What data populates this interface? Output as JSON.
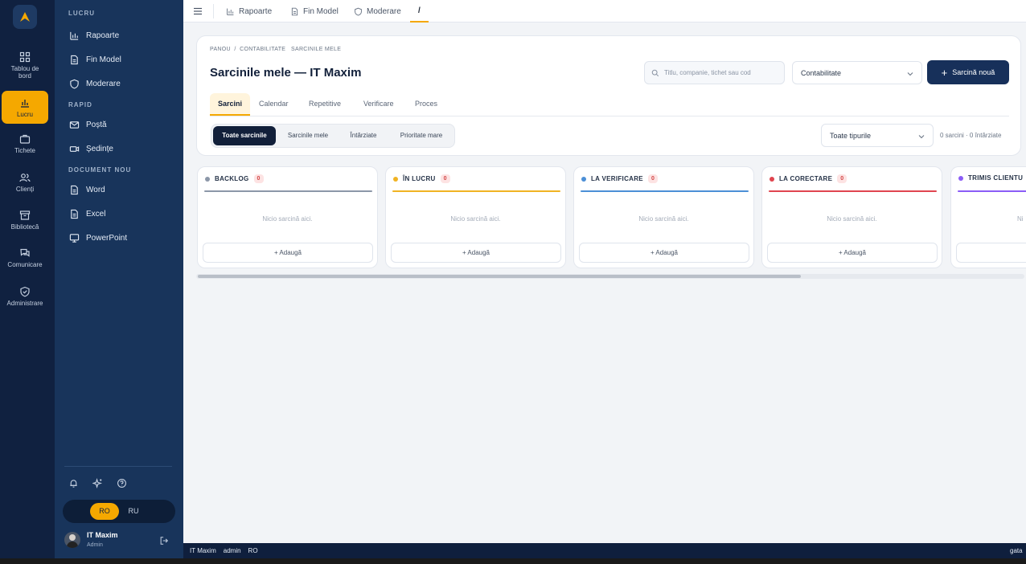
{
  "colors": {
    "accent": "#f5a800",
    "rail_bg": "#102140",
    "panel_bg": "#18345b",
    "primary_btn": "#17305a",
    "status_ok": "#46d36a"
  },
  "rail": {
    "items": [
      {
        "label": "Tablou de bord",
        "icon": "grid-icon"
      },
      {
        "label": "Lucru",
        "icon": "bar-chart-icon",
        "active": true
      },
      {
        "label": "Tichete",
        "icon": "briefcase-icon"
      },
      {
        "label": "Clienți",
        "icon": "users-icon"
      },
      {
        "label": "Bibliotecă",
        "icon": "archive-icon"
      },
      {
        "label": "Comunicare",
        "icon": "chat-icon"
      },
      {
        "label": "Administrare",
        "icon": "shield-check-icon"
      }
    ]
  },
  "panel": {
    "section_work": "LUCRU",
    "section_quick": "RAPID",
    "section_newdoc": "DOCUMENT NOU",
    "items": [
      {
        "label": "Rapoarte",
        "icon": "bar-chart-icon"
      },
      {
        "label": "Fin Model",
        "icon": "document-icon"
      },
      {
        "label": "Moderare",
        "icon": "shield-icon"
      },
      {
        "label": "Poștă",
        "icon": "mail-icon"
      },
      {
        "label": "Ședințe",
        "icon": "video-icon"
      },
      {
        "label": "Word",
        "icon": "document-icon"
      },
      {
        "label": "Excel",
        "icon": "document-icon"
      },
      {
        "label": "PowerPoint",
        "icon": "monitor-icon"
      }
    ],
    "lang": {
      "ro": "RO",
      "ru": "RU",
      "selected": "RO"
    },
    "user": {
      "name": "IT Maxim",
      "role": "Admin"
    }
  },
  "topbar": {
    "tabs": [
      {
        "label": "Rapoarte",
        "icon": "bar-chart-icon"
      },
      {
        "label": "Fin Model",
        "icon": "document-icon"
      },
      {
        "label": "Moderare",
        "icon": "shield-icon"
      },
      {
        "label": "/",
        "active": true
      }
    ]
  },
  "header": {
    "breadcrumb": "PANOU  /  CONTABILITATE   SARCINILE MELE",
    "title": "Sarcinile mele — IT Maxim",
    "search_placeholder": "Titlu, companie, tichet sau cod",
    "department": "Contabilitate",
    "new_task": "Sarcină nouă"
  },
  "tabs": [
    "Sarcini",
    "Calendar",
    "Repetitive",
    "Verificare",
    "Proces"
  ],
  "filters": {
    "segments": [
      "Toate sarcinile",
      "Sarcinile mele",
      "Întârziate",
      "Prioritate mare"
    ],
    "type_select": "Toate tipurile",
    "counts": "0 sarcini · 0 întârziate"
  },
  "board": {
    "empty_text": "Nicio sarcină aici.",
    "add_label": "+ Adaugă",
    "columns": [
      {
        "title": "BACKLOG",
        "count": "0",
        "color": "#8c97a8"
      },
      {
        "title": "ÎN LUCRU",
        "count": "0",
        "color": "#f0b323"
      },
      {
        "title": "LA VERIFICARE",
        "count": "0",
        "color": "#4c8fd6"
      },
      {
        "title": "LA CORECTARE",
        "count": "0",
        "color": "#e0454f"
      },
      {
        "title": "TRIMIS CLIENTU",
        "count": "",
        "color": "#8b5cf6"
      }
    ],
    "partial_empty_text": "Ni"
  },
  "statusbar": {
    "user": "IT Maxim",
    "role": "admin",
    "lang": "RO",
    "state": "gata"
  }
}
